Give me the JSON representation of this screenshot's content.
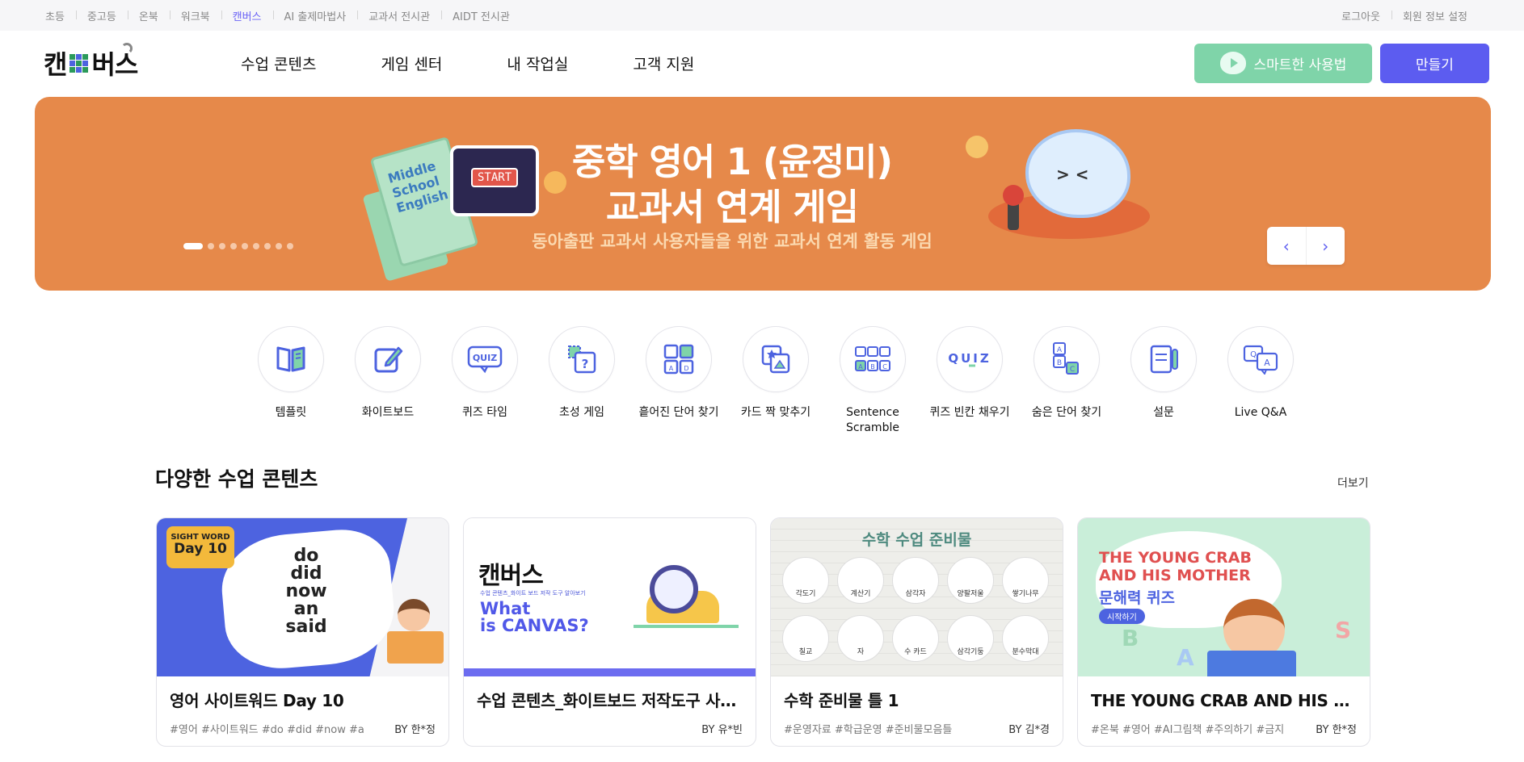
{
  "topbar": {
    "left": [
      "초등",
      "중고등",
      "온북",
      "워크북",
      "캔버스",
      "AI 출제마법사",
      "교과서 전시관",
      "AIDT 전시관"
    ],
    "active_index": 4,
    "right": [
      "로그아웃",
      "회원 정보 설정"
    ]
  },
  "header": {
    "logo_left": "캔",
    "logo_right": "버스",
    "nav": [
      "수업 콘텐츠",
      "게임 센터",
      "내 작업실",
      "고객 지원"
    ],
    "guide_button": "스마트한 사용법",
    "make_button": "만들기"
  },
  "banner": {
    "title_line1": "중학 영어 1 (윤정미)",
    "title_line2": "교과서 연계 게임",
    "subtitle": "동아출판 교과서 사용자들을 위한 교과서 연계 활동 게임",
    "book_text": "Middle School English",
    "game_start": "START",
    "slide_count": 9,
    "active_slide": 0,
    "prev_label": "‹",
    "next_label": "›"
  },
  "templates": [
    {
      "label": "템플릿",
      "icon": "book-icon"
    },
    {
      "label": "화이트보드",
      "icon": "pencil-edit-icon"
    },
    {
      "label": "퀴즈 타임",
      "icon": "quiz-bubble-icon"
    },
    {
      "label": "초성 게임",
      "icon": "question-card-icon"
    },
    {
      "label": "흩어진 단어 찾기",
      "icon": "letter-grid-icon"
    },
    {
      "label": "카드 짝 맞추기",
      "icon": "card-match-icon"
    },
    {
      "label": "Sentence Scramble",
      "icon": "abc-blocks-icon"
    },
    {
      "label": "퀴즈 빈칸 채우기",
      "icon": "quiz-blank-icon"
    },
    {
      "label": "숨은 단어 찾기",
      "icon": "hidden-letters-icon"
    },
    {
      "label": "설문",
      "icon": "survey-icon"
    },
    {
      "label": "Live Q&A",
      "icon": "qa-bubble-icon"
    }
  ],
  "section": {
    "title": "다양한 수업 콘텐츠",
    "more": "더보기"
  },
  "cards": [
    {
      "title": "영어 사이트워드 Day 10",
      "tags": "#영어 #사이트워드 #do #did #now #an #said",
      "by": "BY 한*정",
      "thumb": {
        "badge_top": "SIGHT WORD",
        "badge_day": "Day 10",
        "words": [
          "do",
          "did",
          "now",
          "an",
          "said"
        ]
      }
    },
    {
      "title": "수업 콘텐츠_화이트보드 저작도구 사용법 알아보기",
      "tags": "",
      "by": "BY 유*빈",
      "thumb": {
        "logo": "캔버스",
        "small": "수업 콘텐츠_화이트 보드 저작 도구 알아보기",
        "what_line1": "What",
        "what_line2": "is CANVAS?"
      }
    },
    {
      "title": "수학 준비물 틀 1",
      "tags": "#운영자료 #학급운영 #준비물모음틀",
      "by": "BY 김*경",
      "thumb": {
        "heading": "수학 수업 준비물",
        "items": [
          "각도기",
          "계산기",
          "삼각자",
          "양팔저울",
          "쌓기나무",
          "칠교",
          "자",
          "수 카드",
          "삼각기둥",
          "분수막대"
        ]
      }
    },
    {
      "title": "THE YOUNG CRAB AND HIS MOTHER 문해력 퀴즈",
      "tags": "#온북 #영어 #AI그림책 #주의하기 #금지",
      "by": "BY 한*정",
      "thumb": {
        "title_line1": "THE YOUNG CRAB",
        "title_line2": "AND HIS MOTHER",
        "subtitle": "문해력 퀴즈",
        "pill": "시작하기"
      }
    }
  ],
  "colors": {
    "accent": "#5c5cf0",
    "guide_green": "#7fd4a9",
    "banner_orange": "#e6894a"
  }
}
